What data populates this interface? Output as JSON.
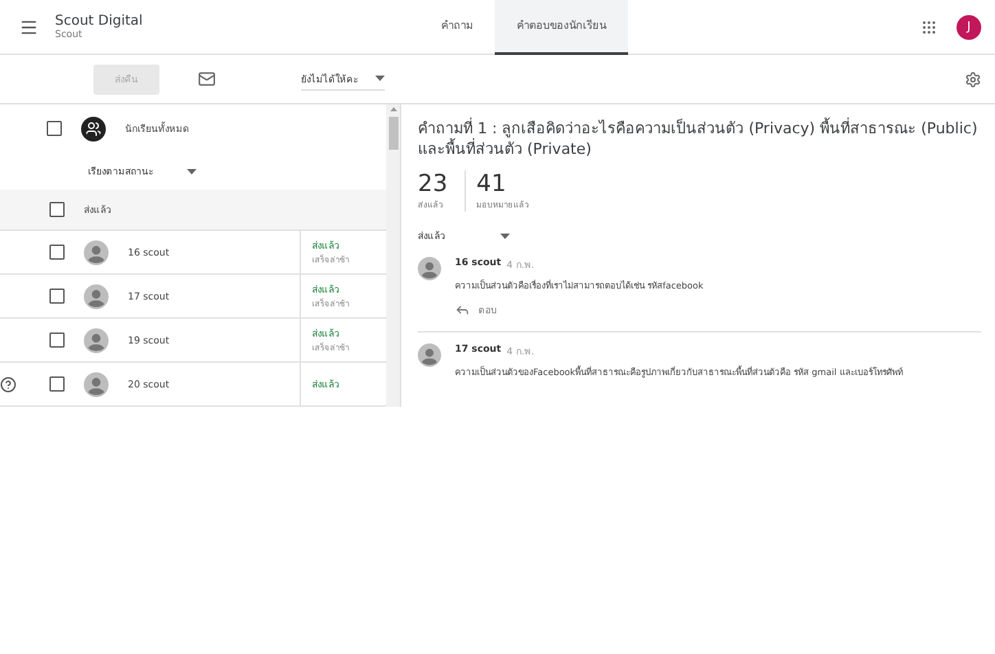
{
  "app": {
    "title": "Scout Digital",
    "subtitle": "Scout",
    "avatar": "J"
  },
  "tabs": [
    {
      "label": "คำถาม",
      "selected": false
    },
    {
      "label": "คำตอบของนักเรียน",
      "selected": true
    }
  ],
  "toolbar": {
    "return_button": {
      "label": "ส่งคืน",
      "disabled": true
    },
    "grade_filter": "ยังไม่ได้ให้คะ"
  },
  "student_list": {
    "all_students": {
      "label": "นักเรียนทั้งหมด",
      "checked": false
    },
    "sort": "เรียงตามสถานะ",
    "group": {
      "label": "ส่งแล้ว",
      "checked": false
    },
    "rows": [
      {
        "name": "16 scout",
        "status": "ส่งแล้ว",
        "note": "เสร็จล่าช้า",
        "checked": false
      },
      {
        "name": "17 scout",
        "status": "ส่งแล้ว",
        "note": "เสร็จล่าช้า",
        "checked": false
      },
      {
        "name": "19 scout",
        "status": "ส่งแล้ว",
        "note": "เสร็จล่าช้า",
        "checked": false
      },
      {
        "name": "20 scout",
        "status": "ส่งแล้ว",
        "checked": false
      }
    ]
  },
  "question": {
    "title": "คำถามที่ 1 : ลูกเสือคิดว่าอะไรคือความเป็นส่วนตัว (Privacy) พื้นที่สาธารณะ (Public) และพื้นที่ส่วนตัว (Private)"
  },
  "stats": [
    {
      "value": "23",
      "label": "ส่งแล้ว"
    },
    {
      "value": "41",
      "label": "มอบหมายแล้ว"
    }
  ],
  "answer_filter": "ส่งแล้ว",
  "answers": [
    {
      "author": "16 scout",
      "date": "4 ก.พ.",
      "text": "ความเป็นส่วนตัวคือเรื่องที่เราไม่สามารถตอบได้เช่น รหัสfacebook",
      "reply": "ตอบ"
    },
    {
      "author": "17 scout",
      "date": "4 ก.พ.",
      "text": "ความเป็นส่วนตัวของFacebookพื้นที่สาธารณะคือรูปภาพเกี่ยวกับสาธารณะพื้นที่ส่วนตัวคือ รหัส gmail และเบอร์โทรศัพท์"
    }
  ]
}
